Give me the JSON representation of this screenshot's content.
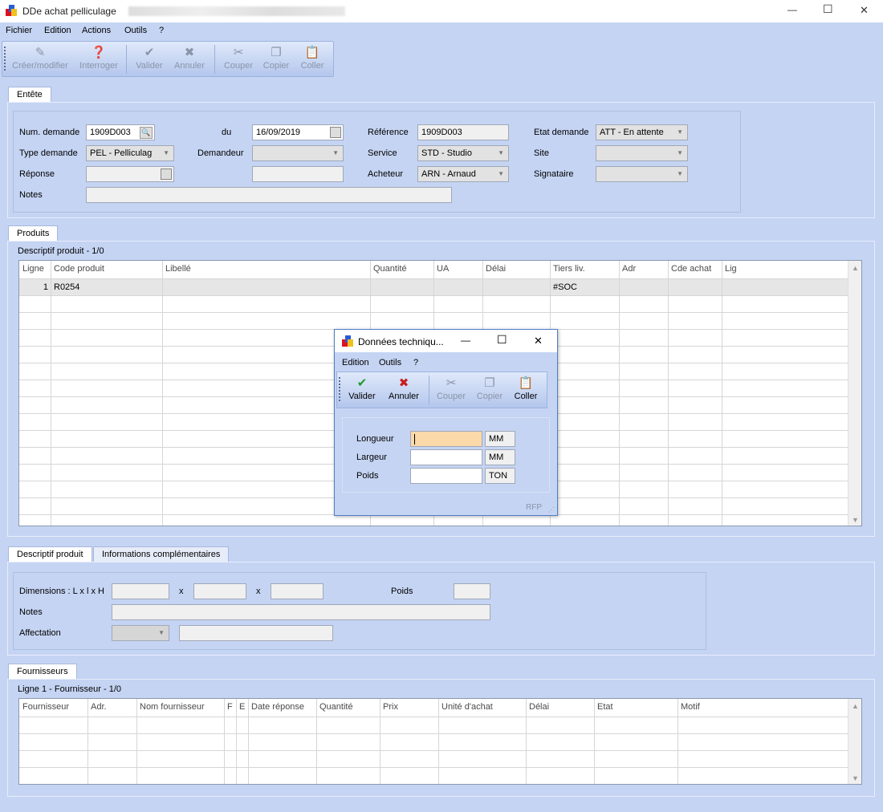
{
  "window": {
    "title": "DDe achat pelliculage",
    "controls": {
      "minimize": "—",
      "maximize": "☐",
      "close": "✕"
    }
  },
  "menu": [
    "Fichier",
    "Edition",
    "Actions",
    "Outils",
    "?"
  ],
  "toolbar": [
    {
      "label": "Créer/modifier",
      "icon": "edit-icon"
    },
    {
      "label": "Interroger",
      "icon": "query-icon"
    },
    {
      "label": "Valider",
      "icon": "check-icon"
    },
    {
      "label": "Annuler",
      "icon": "cancel-icon"
    },
    {
      "label": "Couper",
      "icon": "scissors-icon"
    },
    {
      "label": "Copier",
      "icon": "copy-icon"
    },
    {
      "label": "Coller",
      "icon": "paste-icon"
    }
  ],
  "entete": {
    "tab": "Entête",
    "num_demande_label": "Num. demande",
    "num_demande": "1909D003",
    "du_label": "du",
    "du": "16/09/2019",
    "reference_label": "Référence",
    "reference": "1909D003",
    "etat_label": "Etat demande",
    "etat": "ATT - En attente",
    "type_label": "Type demande",
    "type": "PEL - Pelliculag",
    "demandeur_label": "Demandeur",
    "demandeur": "",
    "service_label": "Service",
    "service": "STD - Studio",
    "site_label": "Site",
    "site": "",
    "reponse_label": "Réponse",
    "reponse": "",
    "acheteur_label": "Acheteur",
    "acheteur": "ARN - Arnaud",
    "signataire_label": "Signataire",
    "signataire": "",
    "notes_label": "Notes",
    "notes": ""
  },
  "produits": {
    "tab": "Produits",
    "caption": "Descriptif produit - 1/0",
    "columns": [
      "Ligne",
      "Code produit",
      "Libellé",
      "Quantité",
      "UA",
      "Délai",
      "Tiers liv.",
      "Adr",
      "Cde achat",
      "Lig"
    ],
    "rows": [
      {
        "ligne": "1",
        "code": "R0254",
        "tiers": "#SOC"
      }
    ]
  },
  "descriptif": {
    "tabs": [
      "Descriptif produit",
      "Informations complémentaires"
    ],
    "dimensions_label": "Dimensions : L x l x H",
    "x1": "x",
    "x2": "x",
    "poids_label": "Poids",
    "notes_label": "Notes",
    "affectation_label": "Affectation"
  },
  "fournisseurs": {
    "tab": "Fournisseurs",
    "caption": "Ligne 1 - Fournisseur - 1/0",
    "columns": [
      "Fournisseur",
      "Adr.",
      "Nom fournisseur",
      "F",
      "E",
      "Date réponse",
      "Quantité",
      "Prix",
      "Unité d'achat",
      "Délai",
      "Etat",
      "Motif"
    ]
  },
  "dialog": {
    "title": "Données techniqu...",
    "menu": [
      "Edition",
      "Outils",
      "?"
    ],
    "toolbar": [
      {
        "label": "Valider",
        "icon": "check-icon"
      },
      {
        "label": "Annuler",
        "icon": "cancel-icon"
      },
      {
        "label": "Couper",
        "icon": "scissors-icon"
      },
      {
        "label": "Copier",
        "icon": "copy-icon"
      },
      {
        "label": "Coller",
        "icon": "paste-icon"
      }
    ],
    "fields": [
      {
        "label": "Longueur",
        "value": "",
        "unit": "MM"
      },
      {
        "label": "Largeur",
        "value": "",
        "unit": "MM"
      },
      {
        "label": "Poids",
        "value": "",
        "unit": "TON"
      }
    ],
    "footer": "RFP"
  },
  "colors": {
    "background": "#c5d4f3",
    "valider": "#1e9c2a",
    "annuler": "#c81e1e",
    "active_field": "#fcd9a8"
  }
}
